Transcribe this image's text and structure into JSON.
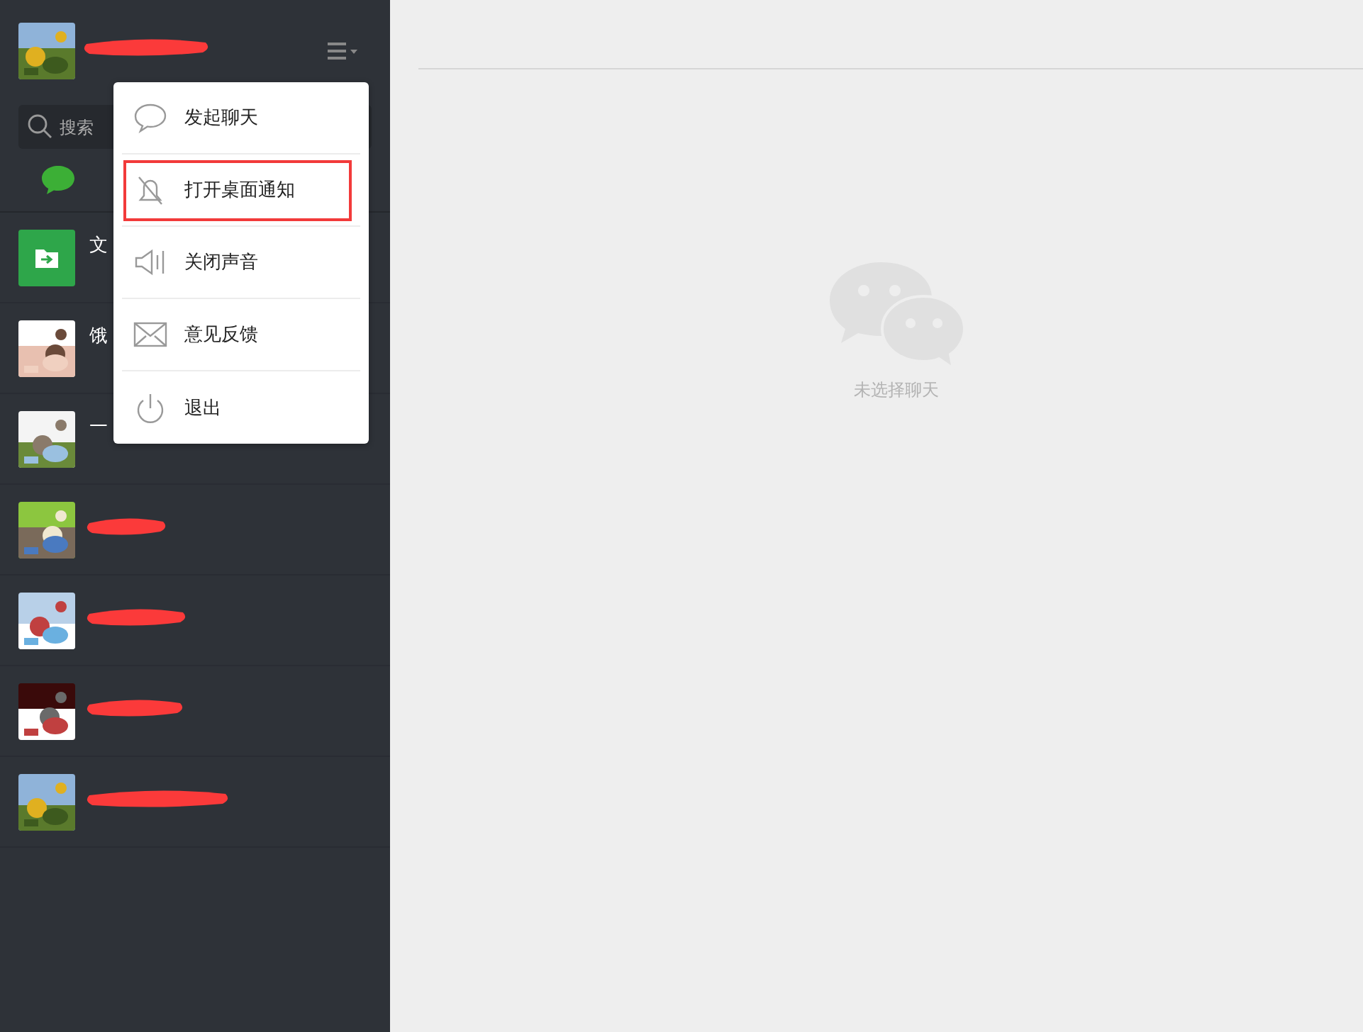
{
  "profile": {
    "name_redacted": true
  },
  "search": {
    "placeholder": "搜索"
  },
  "nav_tabs": [
    {
      "kind": "chat",
      "selected": true
    }
  ],
  "chats": [
    {
      "avatar": {
        "kind": "file-icon"
      },
      "name": "文",
      "name_redacted": false
    },
    {
      "name": "饿",
      "name_redacted": false
    },
    {
      "name": "一",
      "name_redacted": false
    },
    {
      "name_redacted": true
    },
    {
      "name_redacted": true
    },
    {
      "name_redacted": true
    },
    {
      "name_redacted": true
    }
  ],
  "menu": {
    "items": [
      {
        "kind": "chat",
        "label": "发起聊天",
        "highlighted": false
      },
      {
        "kind": "bell-off",
        "label": "打开桌面通知",
        "highlighted": true
      },
      {
        "kind": "speaker",
        "label": "关闭声音",
        "highlighted": false
      },
      {
        "kind": "mail",
        "label": "意见反馈",
        "highlighted": false
      },
      {
        "kind": "power",
        "label": "退出",
        "highlighted": false
      }
    ]
  },
  "empty_state": {
    "text": "未选择聊天"
  }
}
